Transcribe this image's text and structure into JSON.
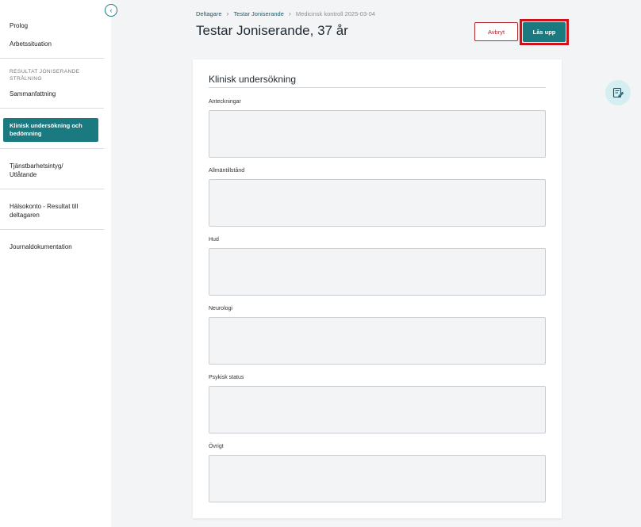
{
  "sidebar": {
    "collapse_glyph": "‹",
    "items": {
      "prolog": "Prolog",
      "arbetssituation": "Arbetssituation",
      "section_heading": "RESULTAT JONISERANDE STRÅLNING",
      "sammanfattning": "Sammanfattning",
      "klinisk": "Klinisk undersökning och bedömning",
      "tjanstbarhet": "Tjänstbarhetsintyg/ Utlåtande",
      "halsokonto": "Hälsokonto - Resultat till deltagaren",
      "journal": "Journaldokumentation"
    }
  },
  "breadcrumb": {
    "items": [
      "Deltagare",
      "Testar Joniserande",
      "Medicinsk kontroll 2025-03-04"
    ],
    "separator": "›"
  },
  "header": {
    "title": "Testar Joniserande, 37 år",
    "cancel_label": "Avbryt",
    "unlock_label": "Lås upp"
  },
  "card": {
    "title": "Klinisk undersökning",
    "fields": [
      {
        "label": "Anteckningar",
        "value": ""
      },
      {
        "label": "Allmäntillstånd",
        "value": ""
      },
      {
        "label": "Hud",
        "value": ""
      },
      {
        "label": "Neurologi",
        "value": ""
      },
      {
        "label": "Psykisk status",
        "value": ""
      },
      {
        "label": "Övrigt",
        "value": ""
      }
    ]
  },
  "float_button": {
    "icon": "note-edit-icon"
  },
  "colors": {
    "accent": "#1b7a80",
    "danger": "#b3262c",
    "highlight": "#d1101a",
    "background": "#f3f4f6"
  }
}
